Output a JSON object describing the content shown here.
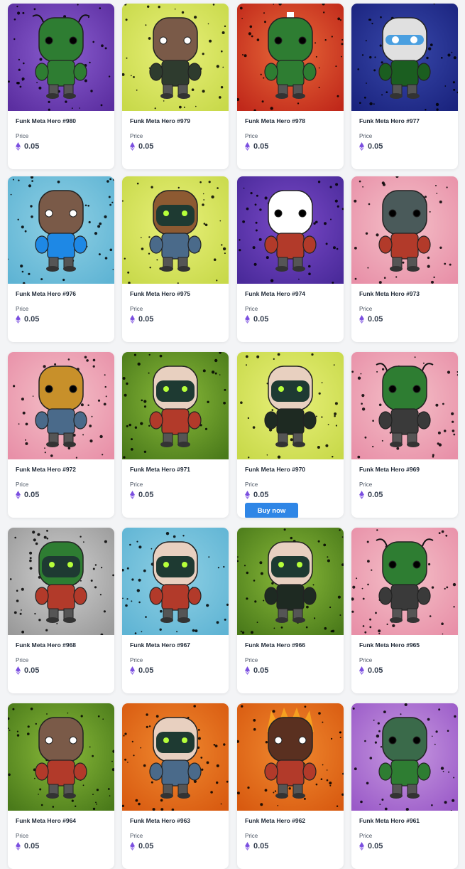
{
  "price_label": "Price",
  "buy_label": "Buy now",
  "eth_color": "#7b4fe0",
  "items": [
    {
      "name": "Funk Meta Hero #980",
      "price": "0.05",
      "bg": [
        "#5b2ea0",
        "#8b5ed0"
      ],
      "head": "#2e7d32",
      "head_type": "antenna",
      "body": "#2e7d32",
      "eyes": "#000"
    },
    {
      "name": "Funk Meta Hero #979",
      "price": "0.05",
      "bg": [
        "#c8d94a",
        "#e8f07a"
      ],
      "head": "#7a5a48",
      "head_type": "hair",
      "body": "#2e3b2e",
      "eyes": "#fff"
    },
    {
      "name": "Funk Meta Hero #978",
      "price": "0.05",
      "bg": [
        "#c0281a",
        "#e86a3a"
      ],
      "head": "#2e7d32",
      "head_type": "crown",
      "body": "#2e7d32",
      "eyes": "#000"
    },
    {
      "name": "Funk Meta Hero #977",
      "price": "0.05",
      "bg": [
        "#1a237e",
        "#3949ab"
      ],
      "head": "#e0e0e0",
      "head_type": "visor",
      "body": "#1b5e20",
      "eyes": "#4a9fe0"
    },
    {
      "name": "Funk Meta Hero #976",
      "price": "0.05",
      "bg": [
        "#5fb4d4",
        "#8fd0e4"
      ],
      "head": "#7a5a48",
      "head_type": "hair",
      "body": "#1e88e5",
      "eyes": "#fff"
    },
    {
      "name": "Funk Meta Hero #975",
      "price": "0.05",
      "bg": [
        "#c8d94a",
        "#e8f07a"
      ],
      "head": "#8d5a32",
      "head_type": "helmet",
      "body": "#4a6a8a",
      "eyes": "#b6ff3a"
    },
    {
      "name": "Funk Meta Hero #974",
      "price": "0.05",
      "bg": [
        "#4a2a9a",
        "#7a4ac8"
      ],
      "head": "#ffffff",
      "head_type": "mask",
      "body": "#b23a2a",
      "eyes": "#000"
    },
    {
      "name": "Funk Meta Hero #973",
      "price": "0.05",
      "bg": [
        "#e890a8",
        "#f4c0c8"
      ],
      "head": "#4a5a5a",
      "head_type": "robot",
      "body": "#b23a2a",
      "eyes": "#000"
    },
    {
      "name": "Funk Meta Hero #972",
      "price": "0.05",
      "bg": [
        "#e890a8",
        "#f4c0c8"
      ],
      "head": "#c8902a",
      "head_type": "robot",
      "body": "#4a6a8a",
      "eyes": "#000"
    },
    {
      "name": "Funk Meta Hero #971",
      "price": "0.05",
      "bg": [
        "#4a7a1a",
        "#8aba3a"
      ],
      "head": "#e8d0c0",
      "head_type": "helmet",
      "body": "#b23a2a",
      "eyes": "#b6ff3a"
    },
    {
      "name": "Funk Meta Hero #970",
      "price": "0.05",
      "bg": [
        "#c8d94a",
        "#e8f07a"
      ],
      "head": "#e8d0c0",
      "head_type": "helmet",
      "body": "#1e2a22",
      "eyes": "#b6ff3a",
      "button": true
    },
    {
      "name": "Funk Meta Hero #969",
      "price": "0.05",
      "bg": [
        "#e890a8",
        "#f4c0c8"
      ],
      "head": "#2e7d32",
      "head_type": "antenna",
      "body": "#3a3a3a",
      "eyes": "#000"
    },
    {
      "name": "Funk Meta Hero #968",
      "price": "0.05",
      "bg": [
        "#9a9a9a",
        "#d0d0d0"
      ],
      "head": "#2e7d32",
      "head_type": "helmet",
      "body": "#b23a2a",
      "eyes": "#b6ff3a"
    },
    {
      "name": "Funk Meta Hero #967",
      "price": "0.05",
      "bg": [
        "#5fb4d4",
        "#8fd0e4"
      ],
      "head": "#e8d0c0",
      "head_type": "helmet",
      "body": "#b23a2a",
      "eyes": "#b6ff3a"
    },
    {
      "name": "Funk Meta Hero #966",
      "price": "0.05",
      "bg": [
        "#4a7a1a",
        "#8aba3a"
      ],
      "head": "#e8d0c0",
      "head_type": "helmet",
      "body": "#1e2a22",
      "eyes": "#b6ff3a"
    },
    {
      "name": "Funk Meta Hero #965",
      "price": "0.05",
      "bg": [
        "#e890a8",
        "#f4c0c8"
      ],
      "head": "#2e7d32",
      "head_type": "antenna",
      "body": "#3a3a3a",
      "eyes": "#000"
    },
    {
      "name": "Funk Meta Hero #964",
      "price": "0.05",
      "bg": [
        "#4a7a1a",
        "#8aba3a"
      ],
      "head": "#7a5a48",
      "head_type": "hair",
      "body": "#b23a2a",
      "eyes": "#fff"
    },
    {
      "name": "Funk Meta Hero #963",
      "price": "0.05",
      "bg": [
        "#d85a10",
        "#f08a30"
      ],
      "head": "#e8d0c0",
      "head_type": "helmet",
      "body": "#4a6a8a",
      "eyes": "#b6ff3a"
    },
    {
      "name": "Funk Meta Hero #962",
      "price": "0.05",
      "bg": [
        "#d85a10",
        "#f08a30"
      ],
      "head": "#5a3020",
      "head_type": "fire",
      "body": "#b23a2a",
      "eyes": "#fff"
    },
    {
      "name": "Funk Meta Hero #961",
      "price": "0.05",
      "bg": [
        "#9a5ac8",
        "#c89ae0"
      ],
      "head": "#3a6a4a",
      "head_type": "robot",
      "body": "#2e7d32",
      "eyes": "#000"
    }
  ]
}
